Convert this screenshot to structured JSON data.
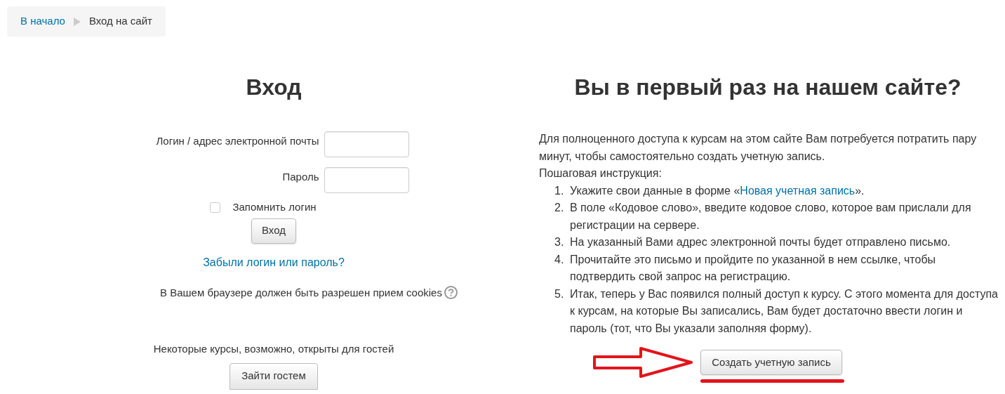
{
  "breadcrumb": [
    {
      "label": "В начало",
      "link": true
    },
    {
      "label": "Вход на сайт",
      "link": false
    }
  ],
  "login": {
    "title": "Вход",
    "fields": [
      {
        "label": "Логин / адрес электронной почты"
      },
      {
        "label": "Пароль"
      }
    ],
    "remember": {
      "label": "Запомнить логин",
      "checked": false
    },
    "submit": "Вход",
    "forgot": "Забыли логин или пароль?",
    "cookies": "В Вашем браузере должен быть разрешен прием cookies",
    "guest_note": "Некоторые курсы, возможно, открыты для гостей",
    "guest_button": "Зайти гостем"
  },
  "signup": {
    "title": "Вы в первый раз на нашем сайте?",
    "intro": "Для полноценного доступа к курсам на этом сайте Вам потребуется потратить пару минут, чтобы самостоятельно создать учетную запись.",
    "steps_heading": "Пошаговая инструкция:",
    "steps": [
      {
        "number": "1.",
        "parts": [
          {
            "text": "Укажите свои данные в форме «",
            "link": false
          },
          {
            "text": "Новая учетная запись",
            "link": true
          },
          {
            "text": "».",
            "link": false
          }
        ]
      },
      {
        "number": "2.",
        "parts": [
          {
            "text": "В поле «Кодовое слово», введите кодовое слово, которое вам прислали для регистрации на сервере.",
            "link": false
          }
        ]
      },
      {
        "number": "3.",
        "parts": [
          {
            "text": "На указанный Вами адрес электронной почты будет отправлено письмо.",
            "link": false
          }
        ]
      },
      {
        "number": "4.",
        "parts": [
          {
            "text": "Прочитайте это письмо и пройдите по указанной в нем ссылке, чтобы подтвердить свой запрос на регистрацию.",
            "link": false
          }
        ]
      },
      {
        "number": "5.",
        "parts": [
          {
            "text": "Итак, теперь у Вас появился полный доступ к курсу. С этого момента для доступа к курсам, на которые Вы записались, Вам будет достаточно ввести логин и пароль (тот, что Вы указали заполняя форму).",
            "link": false
          }
        ]
      }
    ],
    "button": "Создать учетную запись"
  }
}
